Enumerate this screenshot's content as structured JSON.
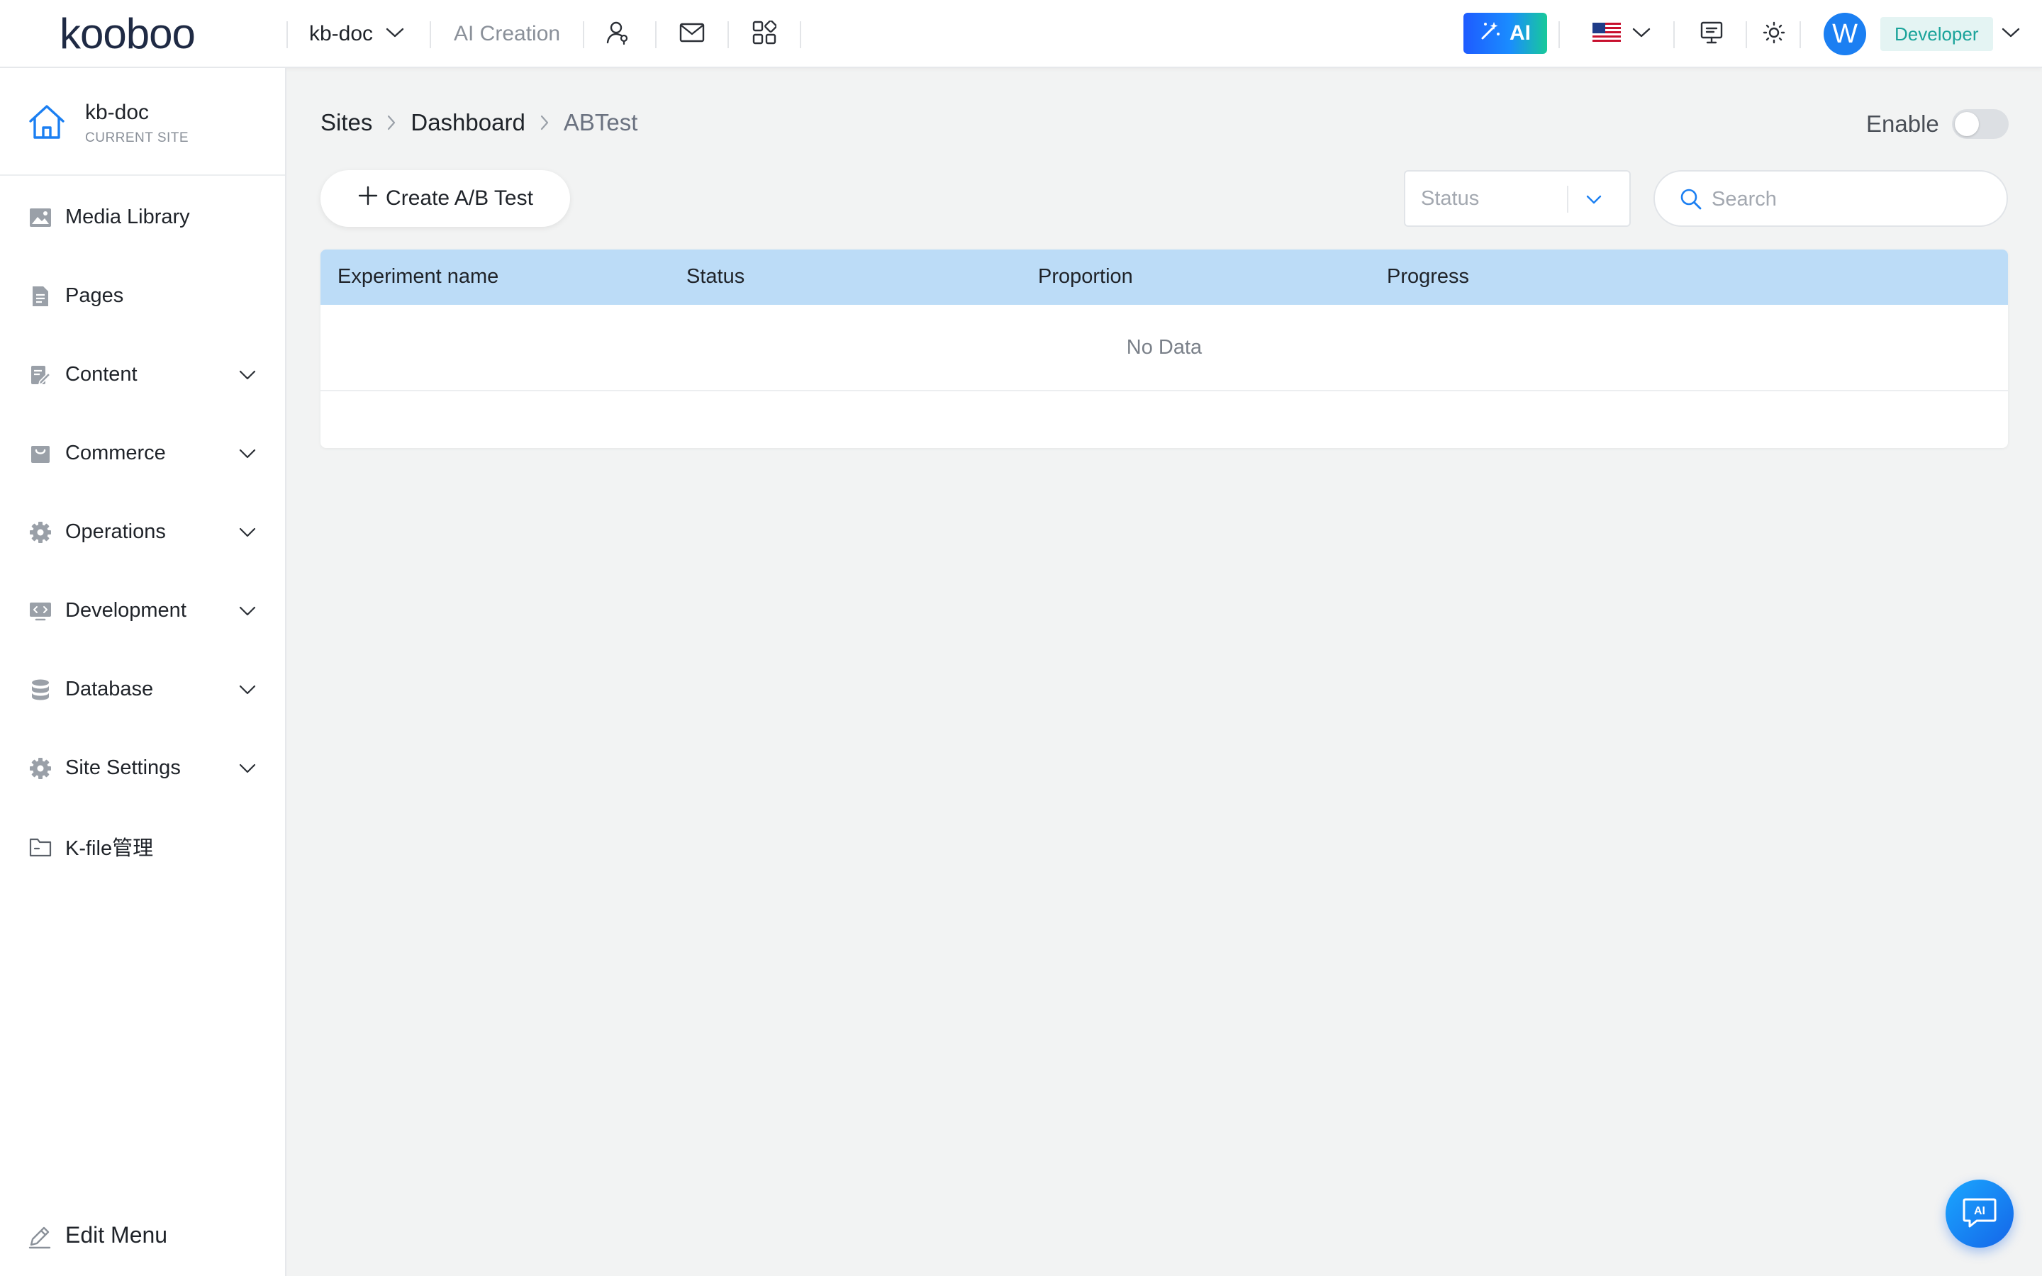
{
  "header": {
    "logo_text": "kooboo",
    "site_name": "kb-doc",
    "ai_creation": "AI Creation",
    "ai_button": "AI",
    "avatar_initial": "W",
    "role": "Developer",
    "language_flag": "🇺🇸"
  },
  "sidebar": {
    "current_site": {
      "name": "kb-doc",
      "caption": "CURRENT SITE"
    },
    "items": [
      {
        "label": "Media Library",
        "icon": "image-icon",
        "expandable": false
      },
      {
        "label": "Pages",
        "icon": "document-icon",
        "expandable": false
      },
      {
        "label": "Content",
        "icon": "edit-doc-icon",
        "expandable": true
      },
      {
        "label": "Commerce",
        "icon": "bag-icon",
        "expandable": true
      },
      {
        "label": "Operations",
        "icon": "gear-icon",
        "expandable": true
      },
      {
        "label": "Development",
        "icon": "code-icon",
        "expandable": true
      },
      {
        "label": "Database",
        "icon": "database-icon",
        "expandable": true
      },
      {
        "label": "Site Settings",
        "icon": "gear-icon",
        "expandable": true
      },
      {
        "label": "K-file管理",
        "icon": "folder-icon",
        "expandable": false
      }
    ],
    "edit_menu": "Edit Menu"
  },
  "breadcrumb": {
    "items": [
      "Sites",
      "Dashboard"
    ],
    "current": "ABTest"
  },
  "enable": {
    "label": "Enable",
    "on": false
  },
  "toolbar": {
    "create_label": "Create A/B Test",
    "status_placeholder": "Status",
    "search_placeholder": "Search"
  },
  "table": {
    "columns": [
      "Experiment name",
      "Status",
      "Proportion",
      "Progress"
    ],
    "empty_text": "No Data"
  },
  "colors": {
    "accent": "#1b7ff2",
    "table_header": "#bcdcf7",
    "role_badge_text": "#1aa39a"
  }
}
